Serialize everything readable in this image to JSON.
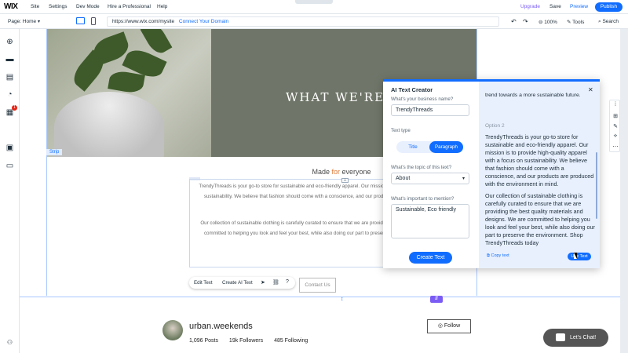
{
  "topbar": {
    "logo": "WIX",
    "menu": [
      "Site",
      "Settings",
      "Dev Mode",
      "Hire a Professional",
      "Help"
    ],
    "upgrade": "Upgrade",
    "save": "Save",
    "preview": "Preview",
    "publish": "Publish"
  },
  "secondbar": {
    "page": "Page: Home",
    "url": "https://www.wix.com/mysite",
    "connect": "Connect Your Domain",
    "zoom": "100%",
    "tools": "Tools",
    "search": "Search"
  },
  "sidebar": {
    "icons": [
      "add-icon",
      "sections-icon",
      "pages-icon",
      "design-icon",
      "apps-icon",
      "media-icon",
      "business-icon"
    ],
    "badge": "1"
  },
  "canvas": {
    "hero_title": "WHAT WE'RE ALL ABOUT",
    "strip_label": "Strip",
    "made_title_1": "Made ",
    "made_title_2": "for",
    "made_title_3": " everyone",
    "para1": "TrendyThreads is your go-to store for sustainable and eco-friendly apparel. Our mission is to provide high-quality apparel with a focus on sustainability. We believe that fashion should come with a conscience, and our products are produced with the environment in mind.",
    "para2": "Our collection of sustainable clothing is carefully curated to ensure that we are providing the best quality materials and designs. We are committed to helping you look and feel your best, while also doing our part to preserve the environment. Shop TrendyThreads today",
    "edit_text": "Edit Text",
    "create_ai_text": "Create AI Text",
    "contact": "Contact Us"
  },
  "profile": {
    "name": "urban.weekends",
    "posts": "1,096 Posts",
    "followers": "19k Followers",
    "following": "485 Following",
    "follow": "Follow"
  },
  "chat": {
    "label": "Let's Chat!"
  },
  "ai_panel": {
    "title": "AI Text Creator",
    "business_label": "What's your business name?",
    "business_value": "TrendyThreads",
    "text_type_label": "Text type",
    "type_title": "Title",
    "type_paragraph": "Paragraph",
    "topic_label": "What's the topic of this text?",
    "topic_value": "About",
    "important_label": "What's important to mention?",
    "important_value": "Sustainable, Eco friendly",
    "create_button": "Create Text",
    "top_fragment": "trend towards a more sustainable future.",
    "option_label": "Option 2",
    "option_para1": "TrendyThreads is your go-to store for sustainable and eco-friendly apparel. Our mission is to provide high-quality apparel with a focus on sustainability. We believe that fashion should come with a conscience, and our products are produced with the environment in mind.",
    "option_para2": "Our collection of sustainable clothing is carefully curated to ensure that we are providing the best quality materials and designs. We are committed to helping you look and feel your best, while also doing our part to preserve the environment. Shop TrendyThreads today",
    "copy_text": "Copy text",
    "use_text": "Use Text"
  },
  "colors": {
    "accent": "#116dff",
    "text": "#20303c",
    "handle": "#7a5cf5"
  }
}
